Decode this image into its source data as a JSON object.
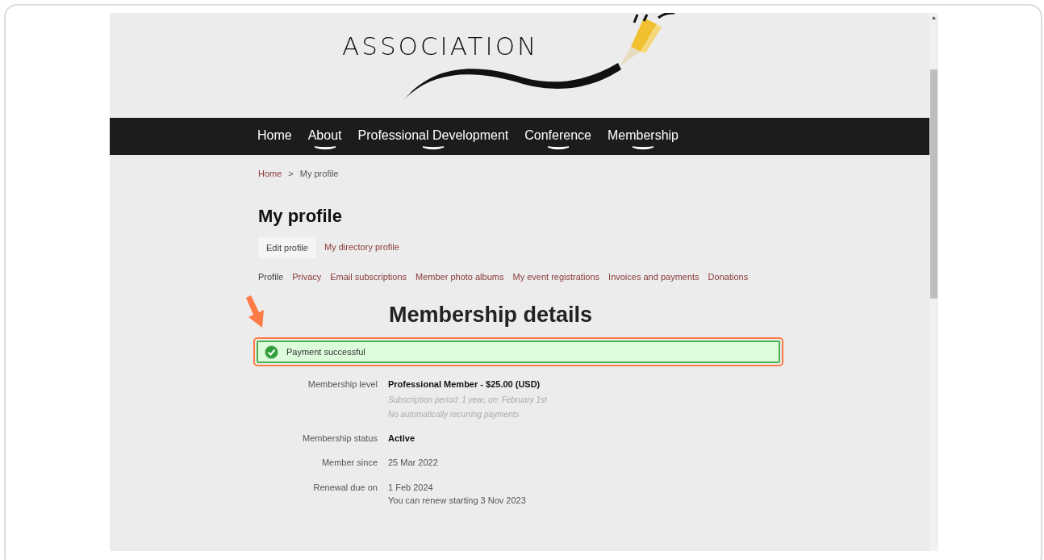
{
  "header": {
    "logo_text": "ASSOCIATION"
  },
  "nav": [
    {
      "label": "Home",
      "has_submenu": false
    },
    {
      "label": "About",
      "has_submenu": true
    },
    {
      "label": "Professional Development",
      "has_submenu": true
    },
    {
      "label": "Conference",
      "has_submenu": true
    },
    {
      "label": "Membership",
      "has_submenu": true
    }
  ],
  "breadcrumb": {
    "items": [
      "Home",
      "My profile"
    ],
    "separator": ">"
  },
  "page_title": "My profile",
  "profile_buttons": [
    {
      "label": "Edit profile",
      "kind": "button"
    },
    {
      "label": "My directory profile",
      "kind": "link"
    }
  ],
  "profile_tabs": [
    {
      "label": "Profile",
      "selected": true
    },
    {
      "label": "Privacy",
      "selected": false
    },
    {
      "label": "Email subscriptions",
      "selected": false
    },
    {
      "label": "Member photo albums",
      "selected": false
    },
    {
      "label": "My event registrations",
      "selected": false
    },
    {
      "label": "Invoices and payments",
      "selected": false
    },
    {
      "label": "Donations",
      "selected": false
    }
  ],
  "section_title": "Membership details",
  "alert": {
    "text": "Payment successful",
    "highlighted": true
  },
  "details": [
    {
      "label": "Membership level",
      "value": "Professional Member - $25.00 (USD)",
      "value_bold": true,
      "notes": [
        "Subscription period: 1 year, on: February 1st",
        "No automatically recurring payments"
      ]
    },
    {
      "label": "Membership status",
      "value": "Active",
      "value_bold": true
    },
    {
      "label": "Member since",
      "value": "25 Mar 2022",
      "value_bold": false
    },
    {
      "label": "Renewal due on",
      "value": "1 Feb 2024",
      "value_bold": false,
      "extra": "You can renew starting 3 Nov 2023"
    }
  ]
}
